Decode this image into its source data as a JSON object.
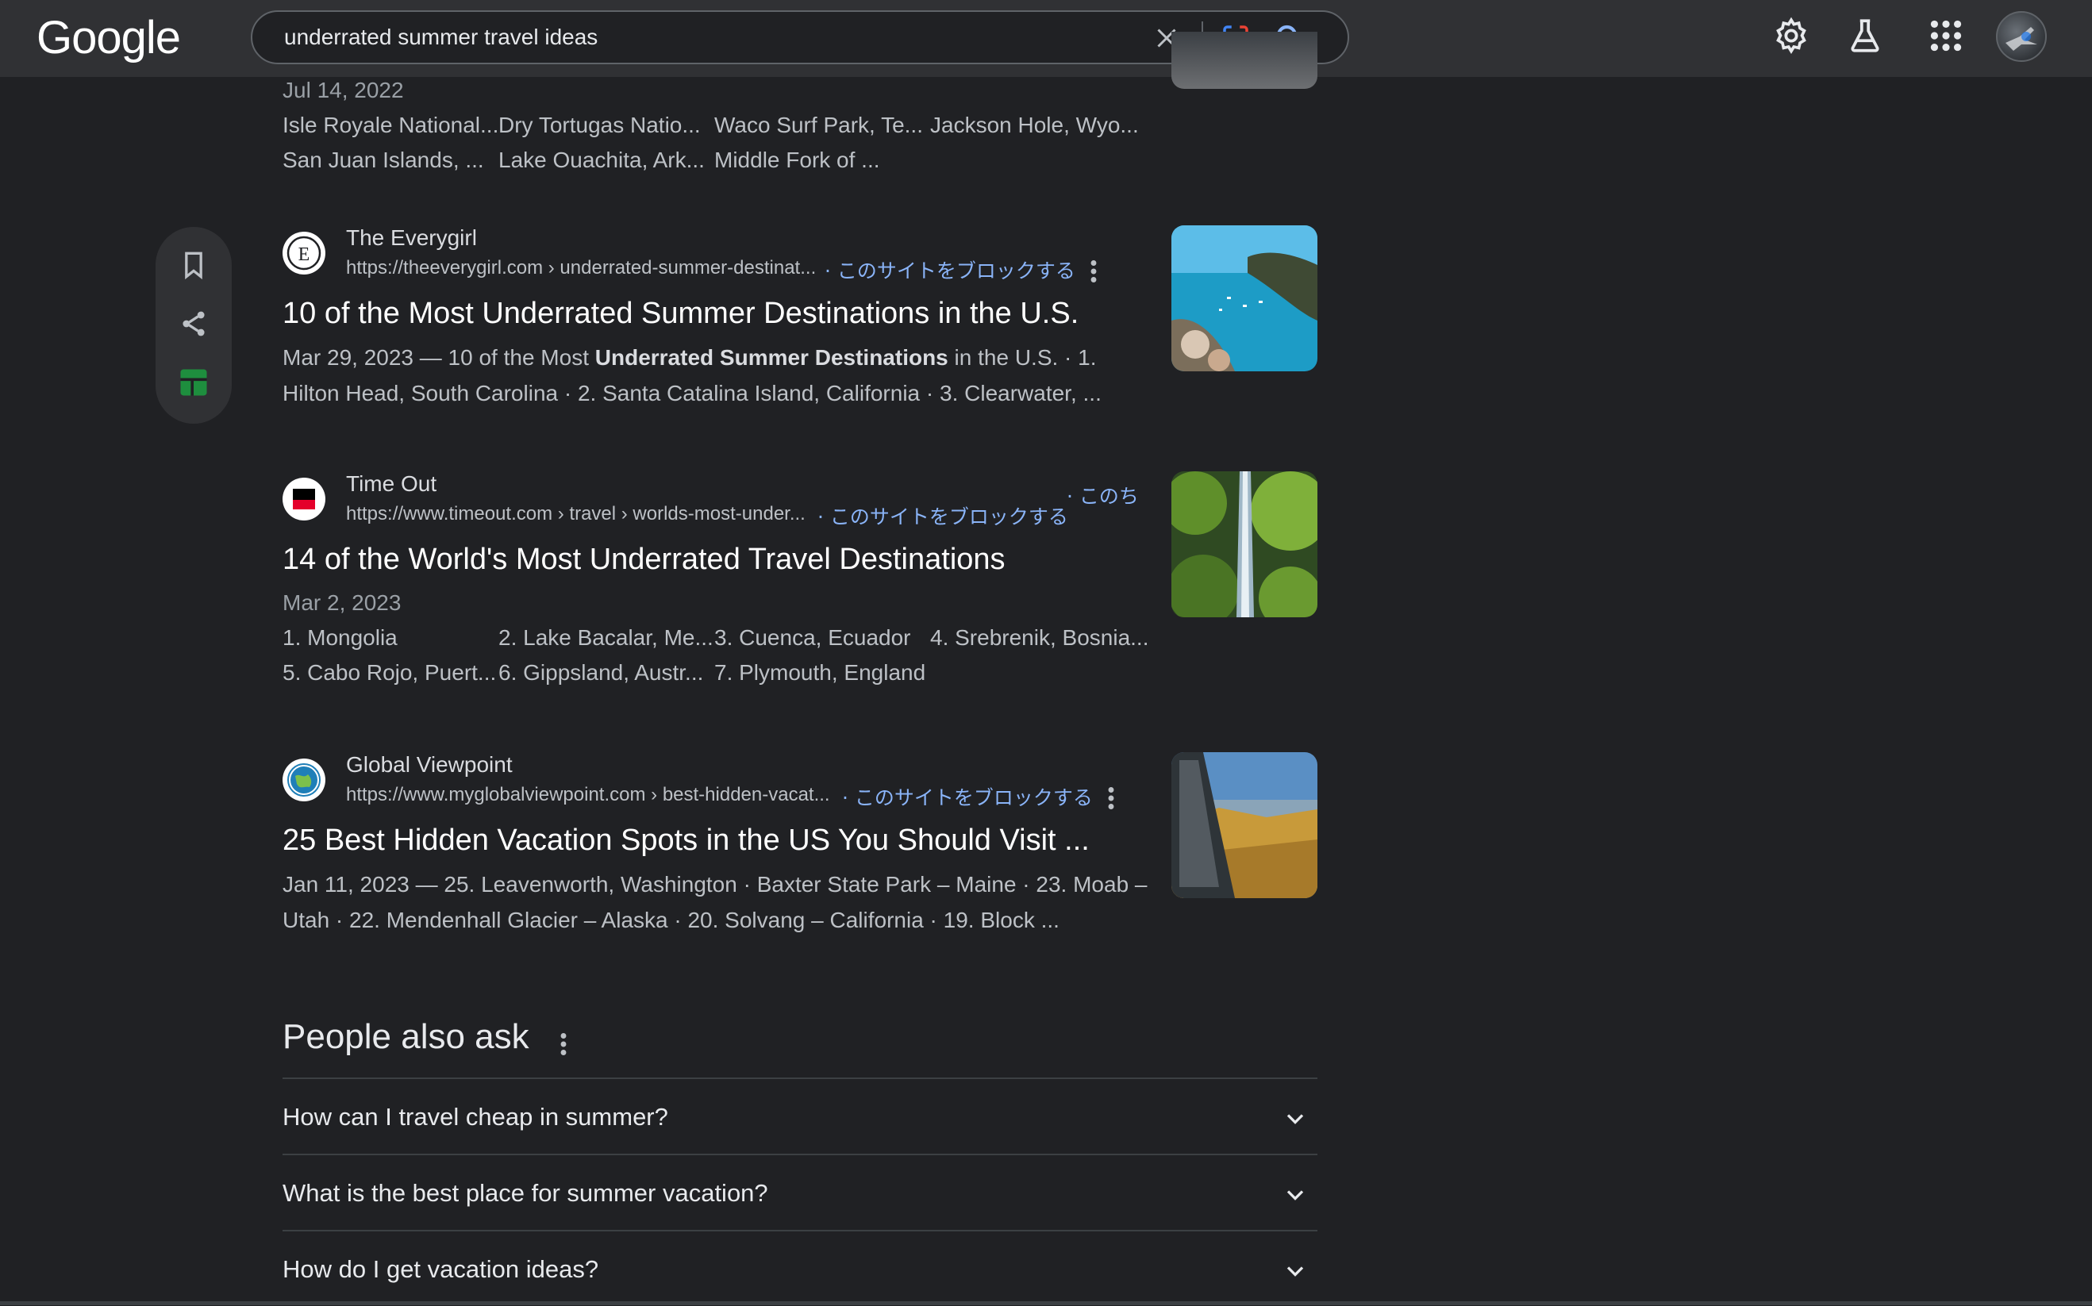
{
  "header": {
    "logo": "Google",
    "search_value": "underrated summer travel ideas"
  },
  "result0": {
    "date": "Jul 14, 2022",
    "row1": [
      "Isle Royale National...",
      "Dry Tortugas Natio...",
      "Waco Surf Park, Te...",
      "Jackson Hole, Wyo..."
    ],
    "row2": [
      "San Juan Islands, ...",
      "Lake Ouachita, Ark...",
      "Middle Fork of ..."
    ]
  },
  "result1": {
    "site": "The Everygirl",
    "url": "https://theeverygirl.com › underrated-summer-destinat...",
    "block": "· このサイトをブロックする",
    "title": "10 of the Most Underrated Summer Destinations in the U.S.",
    "snippet_pre": "Mar 29, 2023 — 10 of the Most ",
    "snippet_bold": "Underrated Summer Destinations",
    "snippet_post": " in the U.S. · 1.",
    "snippet_line2": "Hilton Head, South Carolina · 2. Santa Catalina Island, California · 3. Clearwater, ..."
  },
  "result2": {
    "site": "Time Out",
    "url": "https://www.timeout.com › travel › worlds-most-under...",
    "block": "· このサイトをブロックする",
    "block_extra": "· このち",
    "title": "14 of the World's Most Underrated Travel Destinations",
    "date": "Mar 2, 2023",
    "row1": [
      "1. Mongolia",
      "2. Lake Bacalar, Me...",
      "3. Cuenca, Ecuador",
      "4. Srebrenik, Bosnia..."
    ],
    "row2": [
      "5. Cabo Rojo, Puert...",
      "6. Gippsland, Austr...",
      "7. Plymouth, England"
    ]
  },
  "result3": {
    "site": "Global Viewpoint",
    "url": "https://www.myglobalviewpoint.com › best-hidden-vacat...",
    "block": "· このサイトをブロックする",
    "title": "25 Best Hidden Vacation Spots in the US You Should Visit ...",
    "snippet_line1": "Jan 11, 2023 — 25. Leavenworth, Washington · Baxter State Park – Maine · 23. Moab –",
    "snippet_line2": "Utah · 22. Mendenhall Glacier – Alaska · 20. Solvang – California · 19. Block ..."
  },
  "people_also_ask": {
    "title": "People also ask",
    "questions": [
      "How can I travel cheap in summer?",
      "What is the best place for summer vacation?",
      "How do I get vacation ideas?"
    ]
  },
  "colors": {
    "background": "#202124",
    "header": "#303134",
    "link": "#8ab4f8",
    "title": "#ffffff",
    "text": "#bdc1c6"
  },
  "icons": [
    "close-icon",
    "lens-icon",
    "search-icon",
    "settings-icon",
    "labs-icon",
    "apps-icon",
    "bookmark-icon",
    "share-icon",
    "sheets-icon",
    "more-icon",
    "chevron-down-icon"
  ]
}
